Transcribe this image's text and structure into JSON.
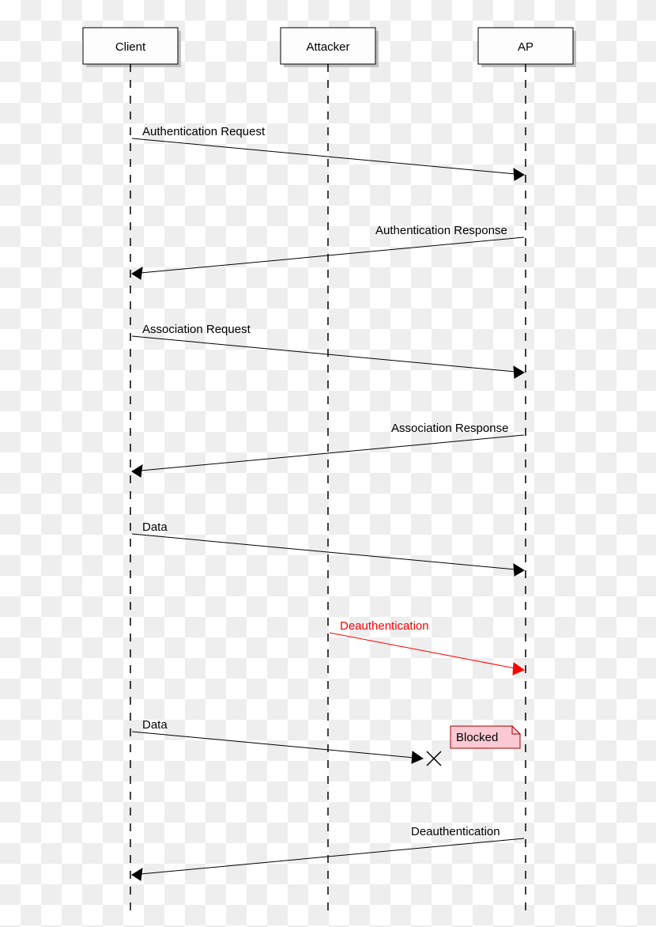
{
  "participants": {
    "client": "Client",
    "attacker": "Attacker",
    "ap": "AP"
  },
  "messages": {
    "m1": "Authentication Request",
    "m2": "Authentication Response",
    "m3": "Association Request",
    "m4": "Association Response",
    "m5": "Data",
    "m6": "Deauthentication",
    "m7": "Data",
    "m8": "Deauthentication"
  },
  "notes": {
    "blocked": "Blocked"
  }
}
